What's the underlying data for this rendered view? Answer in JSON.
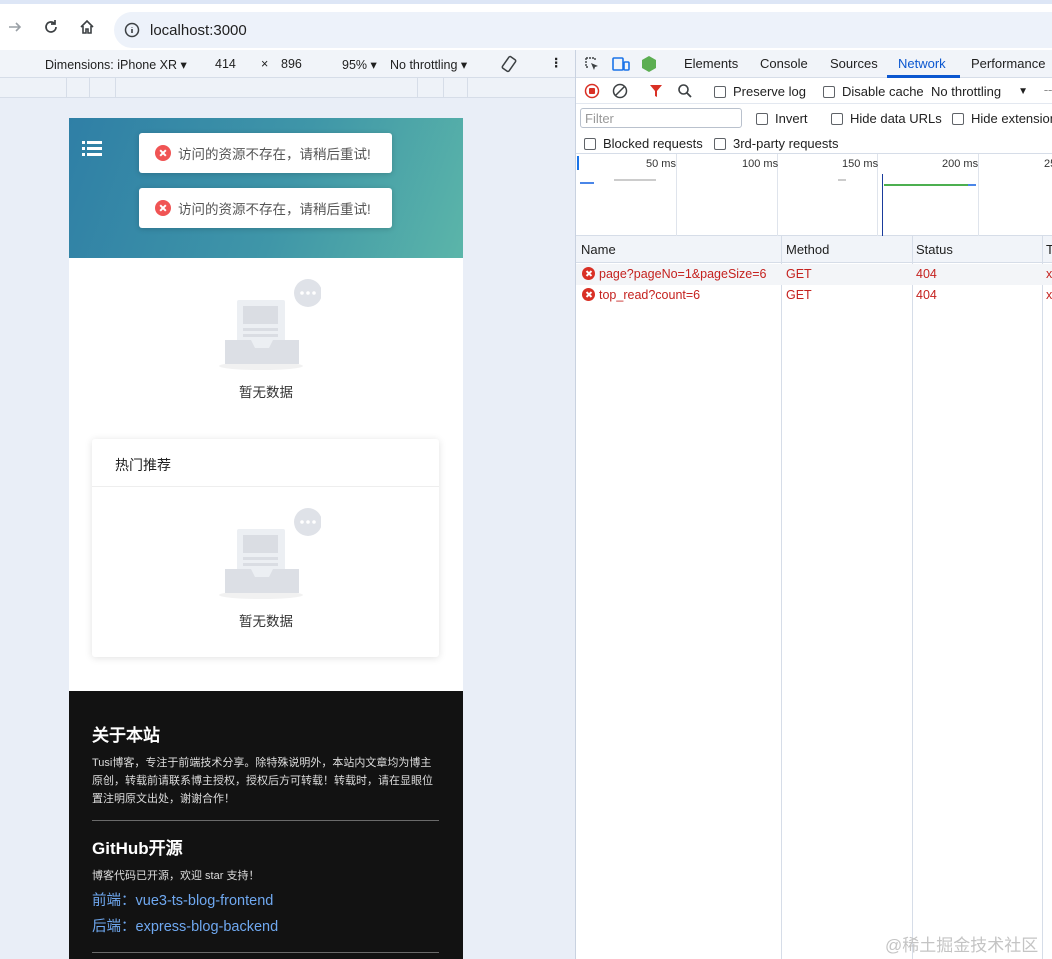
{
  "browser": {
    "url": "localhost:3000"
  },
  "device_toolbar": {
    "dimensions_label": "Dimensions: iPhone XR",
    "width": "414",
    "times": "×",
    "height": "896",
    "zoom": "95%",
    "throttling": "No throttling"
  },
  "page": {
    "toasts": [
      {
        "message": "访问的资源不存在，请稍后重试!"
      },
      {
        "message": "访问的资源不存在，请稍后重试!"
      }
    ],
    "empty_main": "暂无数据",
    "hot": {
      "title": "热门推荐",
      "empty": "暂无数据"
    },
    "footer": {
      "about_title": "关于本站",
      "about_text": "Tusi博客，专注于前端技术分享。除特殊说明外，本站内文章均为博主原创，转载前请联系博主授权，授权后方可转载！转载时，请在显眼位置注明原文出处，谢谢合作！",
      "github_title": "GitHub开源",
      "github_text": "博客代码已开源，欢迎 star 支持！",
      "frontend_link": "前端：vue3-ts-blog-frontend",
      "backend_link": "后端：express-blog-backend"
    }
  },
  "devtools": {
    "tabs": [
      "Elements",
      "Console",
      "Sources",
      "Network",
      "Performance"
    ],
    "active_tab": "Network",
    "toolbar": {
      "preserve_log": "Preserve log",
      "disable_cache": "Disable cache",
      "throttling": "No throttling"
    },
    "filter_placeholder": "Filter",
    "invert": "Invert",
    "hide_data_urls": "Hide data URLs",
    "hide_extension": "Hide extension",
    "blocked_requests": "Blocked requests",
    "third_party": "3rd-party requests",
    "timeline_labels": [
      "50 ms",
      "100 ms",
      "150 ms",
      "200 ms",
      "25"
    ],
    "columns": [
      "Name",
      "Method",
      "Status",
      "T"
    ],
    "requests": [
      {
        "name": "page?pageNo=1&pageSize=6",
        "method": "GET",
        "status": "404",
        "type": "x"
      },
      {
        "name": "top_read?count=6",
        "method": "GET",
        "status": "404",
        "type": "x"
      }
    ],
    "colors": {
      "error": "#c5221f",
      "accent": "#0b57d0"
    }
  },
  "watermark": "@稀土掘金技术社区"
}
